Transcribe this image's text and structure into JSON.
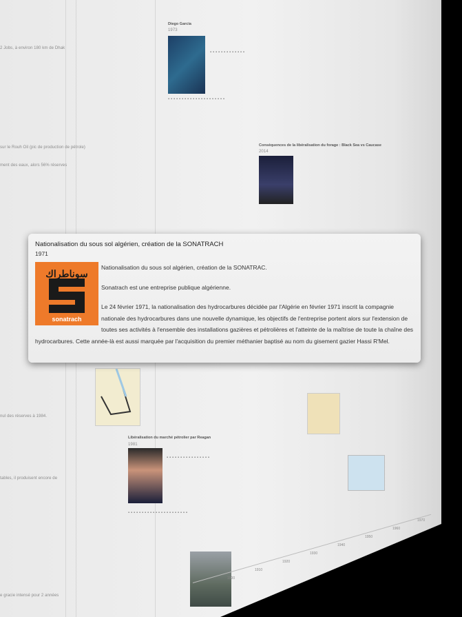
{
  "popup": {
    "title": "Nationalisation du sous sol algérien, création de la SONATRACH",
    "year": "1971",
    "logo": {
      "arabic": "سوناطراك",
      "name": "sonatrach",
      "color": "#ee7a2a"
    },
    "paragraphs": [
      "Nationalisation du sous sol algérien, création de la SONATRAC.",
      "Sonatrach est une entreprise publique algérienne.",
      "Le 24 février 1971, la nationalisation des hydrocarbures décidée par l'Algérie en février 1971 inscrit la compagnie nationale des hydrocarbures dans une nouvelle dynamique, les objectifs de l'entreprise portent alors sur l'extension de toutes ses activités à l'ensemble des installations gazières et pétrolières et l'atteinte de la maîtrise de toute la chaîne des hydrocarbures. Cette année-là est aussi marquée par l'acquisition du premier méthanier baptisé au nom du gisement gazier Hassi R'Mel."
    ]
  },
  "background": {
    "event1": {
      "title": "Diego Garcia",
      "year": "1973"
    },
    "event2": {
      "title": "Libéralisation du marché pétrolier par Reagan",
      "year": "1981"
    },
    "event3": {
      "title": "Conséquences de la libéralisation du forage : Black Sea vs Caucase",
      "year": "2014"
    },
    "left_snippets": [
      "2 Jobs, à environ 180 km de Dhak",
      "sur le Rouh Oil (pic de production de pétrole)",
      "ment des eaux, alors 56% réserves",
      "nul des réserves à 1984.",
      "tables, il produisent encore de",
      "e gracie intensé pour 2 années"
    ],
    "ticks": [
      "1900",
      "1910",
      "1920",
      "1930",
      "1940",
      "1950",
      "1960",
      "1970"
    ]
  }
}
